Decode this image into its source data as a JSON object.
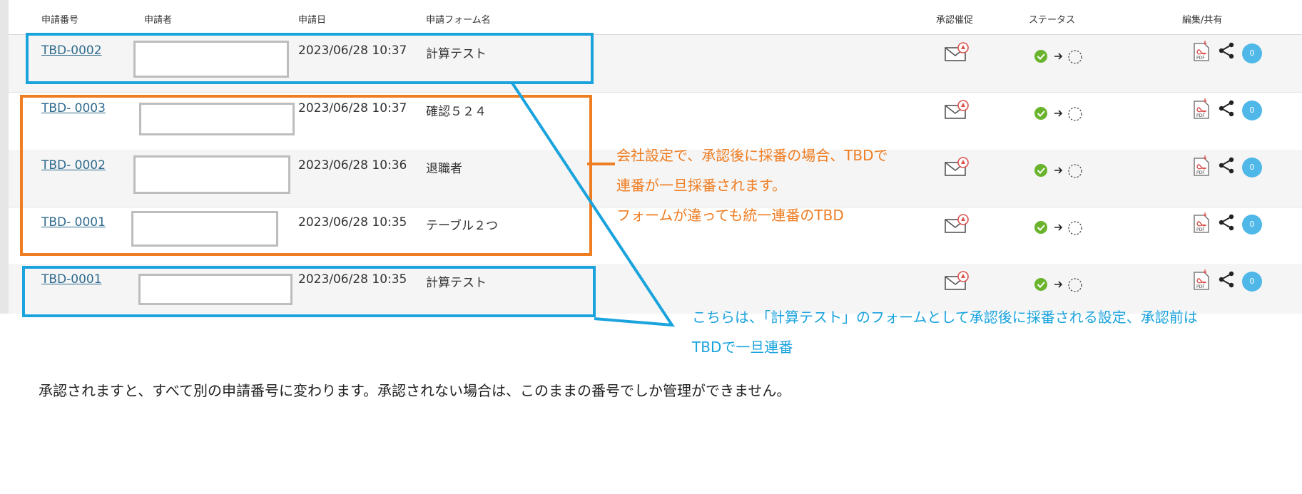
{
  "headers": {
    "app_no": "申請番号",
    "applicant": "申請者",
    "date": "申請日",
    "form": "申請フォーム名",
    "reminder": "承認催促",
    "status": "ステータス",
    "edit_share": "編集/共有"
  },
  "rows": [
    {
      "number": "TBD-0002",
      "date": "2023/06/28 10:37",
      "form": "計算テスト",
      "comments": "0"
    },
    {
      "number": "TBD- 0003",
      "date": "2023/06/28 10:37",
      "form": "確認５２４",
      "comments": "0"
    },
    {
      "number": "TBD- 0002",
      "date": "2023/06/28 10:36",
      "form": "退職者",
      "comments": "0"
    },
    {
      "number": "TBD- 0001",
      "date": "2023/06/28 10:35",
      "form": "テーブル２つ",
      "comments": "0"
    },
    {
      "number": "TBD-0001",
      "date": "2023/06/28 10:35",
      "form": "計算テスト",
      "comments": "0"
    }
  ],
  "annotations": {
    "orange_line1": "会社設定で、承認後に採番の場合、TBDで",
    "orange_line2": "連番が一旦採番されます。",
    "orange_line3": "フォームが違っても統一連番のTBD",
    "blue_line1": "こちらは、「計算テスト」のフォームとして承認後に採番される設定、承認前は",
    "blue_line2": "TBDで一旦連番",
    "bottom": "承認されますと、すべて別の申請番号に変わります。承認されない場合は、このままの番号でしか管理ができません。"
  },
  "colors": {
    "annotation_orange": "#ef7d22",
    "annotation_blue": "#1aa3dd",
    "link": "#2f6b8f",
    "status_ok": "#6ab42d",
    "comment_badge": "#4fb8e8"
  },
  "icons": [
    "mail-alert-icon",
    "check-circle-icon",
    "arrow-right-icon",
    "pending-circle-icon",
    "pdf-icon",
    "share-icon",
    "comment-icon"
  ]
}
